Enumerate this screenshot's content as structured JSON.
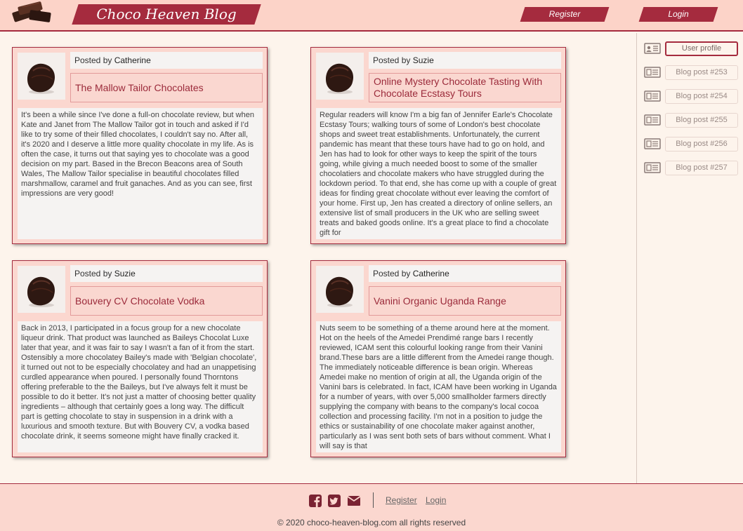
{
  "header": {
    "brand": "Choco Heaven Blog",
    "register_label": "Register",
    "login_label": "Login"
  },
  "posts": [
    {
      "posted_by_prefix": "Posted by",
      "author": "Catherine",
      "title": "The Mallow Tailor Chocolates",
      "body": "It's been a while since I've done a full-on chocolate review, but when Kate and Janet from The Mallow Tailor got in touch and asked if I'd like to try some of their filled chocolates, I couldn't say no. After all, it's 2020 and I deserve a little more quality chocolate in my life. As is often the case, it turns out that saying yes to chocolate was a good decision on my part. Based in the Brecon Beacons area of South Wales, The Mallow Tailor specialise in beautiful chocolates filled marshmallow, caramel and fruit ganaches. And as you can see, first impressions are very good!"
    },
    {
      "posted_by_prefix": "Posted by",
      "author": "Suzie",
      "title": "Online Mystery Chocolate Tasting With Chocolate Ecstasy Tours",
      "body": "Regular readers will know I'm a big fan of Jennifer Earle's Chocolate Ecstasy Tours; walking tours of some of London's best chocolate shops and sweet treat establishments. Unfortunately, the current pandemic has meant that these tours have had to go on hold, and Jen has had to look for other ways to keep the spirit of the tours going, while giving a much needed boost to some of the smaller chocolatiers and chocolate makers who have struggled during the lockdown period. To that end, she has come up with a couple of great ideas for finding great chocolate without ever leaving the comfort of your home. First up, Jen has created a directory of online sellers, an extensive list of small producers in the UK who are selling sweet treats and baked goods online. It's a great place to find a chocolate gift for"
    },
    {
      "posted_by_prefix": "Posted by",
      "author": "Suzie",
      "title": "Bouvery CV Chocolate Vodka",
      "body": "Back in 2013, I participated in a focus group for a new chocolate liqueur drink. That product was launched as Baileys Chocolat Luxe later that year, and it was fair to say I wasn't a fan of it from the start. Ostensibly a more chocolatey Bailey's made with 'Belgian chocolate', it turned out not to be especially chocolatey and had an unappetising curdled appearance when poured. I personally found Thorntons offering preferable to the the Baileys, but I've always felt it must be possible to do it better. It's not just a matter of choosing better quality ingredients – although that certainly goes a long way. The difficult part is getting chocolate to stay in suspension in a drink with a luxurious and smooth texture. But with Bouvery CV, a vodka based chocolate drink, it seems someone might have finally cracked it."
    },
    {
      "posted_by_prefix": "Posted by",
      "author": "Catherine",
      "title": "Vanini Organic Uganda Range",
      "body": "Nuts seem to be something of a theme around here at the moment. Hot on the heels of the Amedei Prendimé range bars I recently reviewed, ICAM sent this colourful looking range from their Vanini brand.These bars are a little different from the Amedei range though. The immediately noticeable difference is bean origin. Whereas Amedei make no mention of origin at all, the Uganda origin of the Vanini bars is celebrated. In fact, ICAM have been working in Uganda for a number of years, with over 5,000 smallholder farmers directly supplying the company with beans to the company's local cocoa collection and processing facility. I'm not in a position to judge the ethics or sustainability of one chocolate maker against another, particularly as I was sent both sets of bars without comment. What I will say is that"
    }
  ],
  "sidebar": {
    "items": [
      {
        "label": "User profile",
        "icon": "id-card-icon"
      },
      {
        "label": "Blog post #253",
        "icon": "newspaper-icon"
      },
      {
        "label": "Blog post #254",
        "icon": "newspaper-icon"
      },
      {
        "label": "Blog post #255",
        "icon": "newspaper-icon"
      },
      {
        "label": "Blog post #256",
        "icon": "newspaper-icon"
      },
      {
        "label": "Blog post #257",
        "icon": "newspaper-icon"
      }
    ]
  },
  "footer": {
    "register_label": "Register",
    "login_label": "Login",
    "copyright": "© 2020 choco-heaven-blog.com all rights reserved"
  },
  "colors": {
    "accent": "#a52b3e",
    "header_bg": "#fcd3c8",
    "page_bg": "#fdf4ec"
  }
}
